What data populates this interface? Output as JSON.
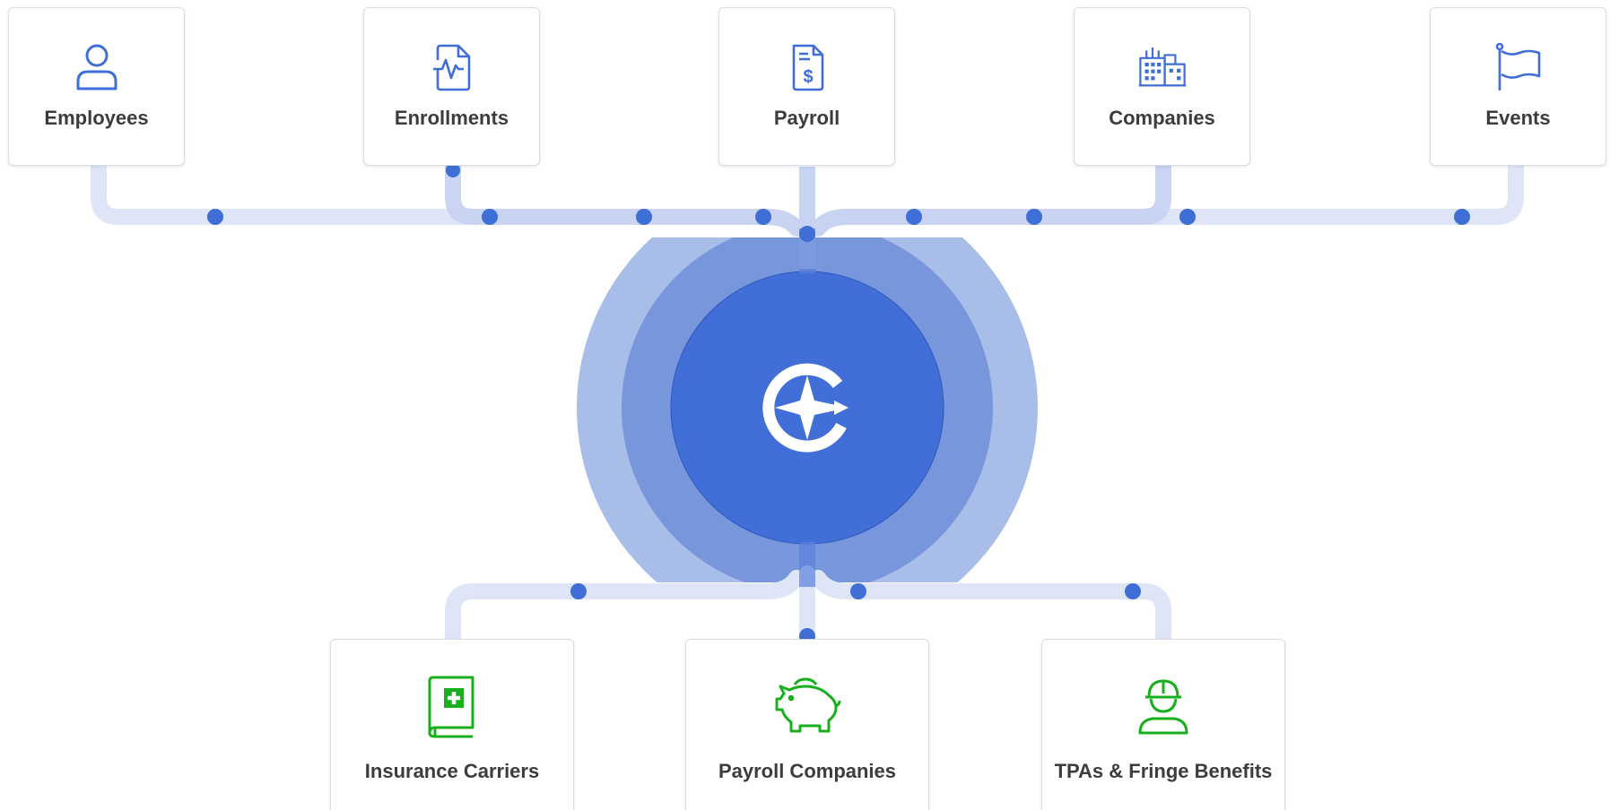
{
  "colors": {
    "top_icon": "#3f6ed6",
    "bottom_icon": "#17b01c",
    "hub_primary": "#426fd7",
    "hub_mid": "#7796dc",
    "hub_outer": "#a9bde9",
    "line_light": "#dde5f7",
    "line_dark": "#b9c8ee",
    "dot": "#3f6ed6",
    "label": "#3c3c3c"
  },
  "sources": [
    {
      "label": "Employees",
      "icon": "user-icon"
    },
    {
      "label": "Enrollments",
      "icon": "document-pulse-icon"
    },
    {
      "label": "Payroll",
      "icon": "document-dollar-icon"
    },
    {
      "label": "Companies",
      "icon": "buildings-icon"
    },
    {
      "label": "Events",
      "icon": "flag-icon"
    }
  ],
  "destinations": [
    {
      "label": "Insurance Carriers",
      "icon": "medical-book-icon"
    },
    {
      "label": "Payroll Companies",
      "icon": "piggy-bank-icon"
    },
    {
      "label": "TPAs & Fringe Benefits",
      "icon": "hard-hat-worker-icon"
    }
  ],
  "hub": {
    "icon": "compass-e-logo-icon"
  }
}
